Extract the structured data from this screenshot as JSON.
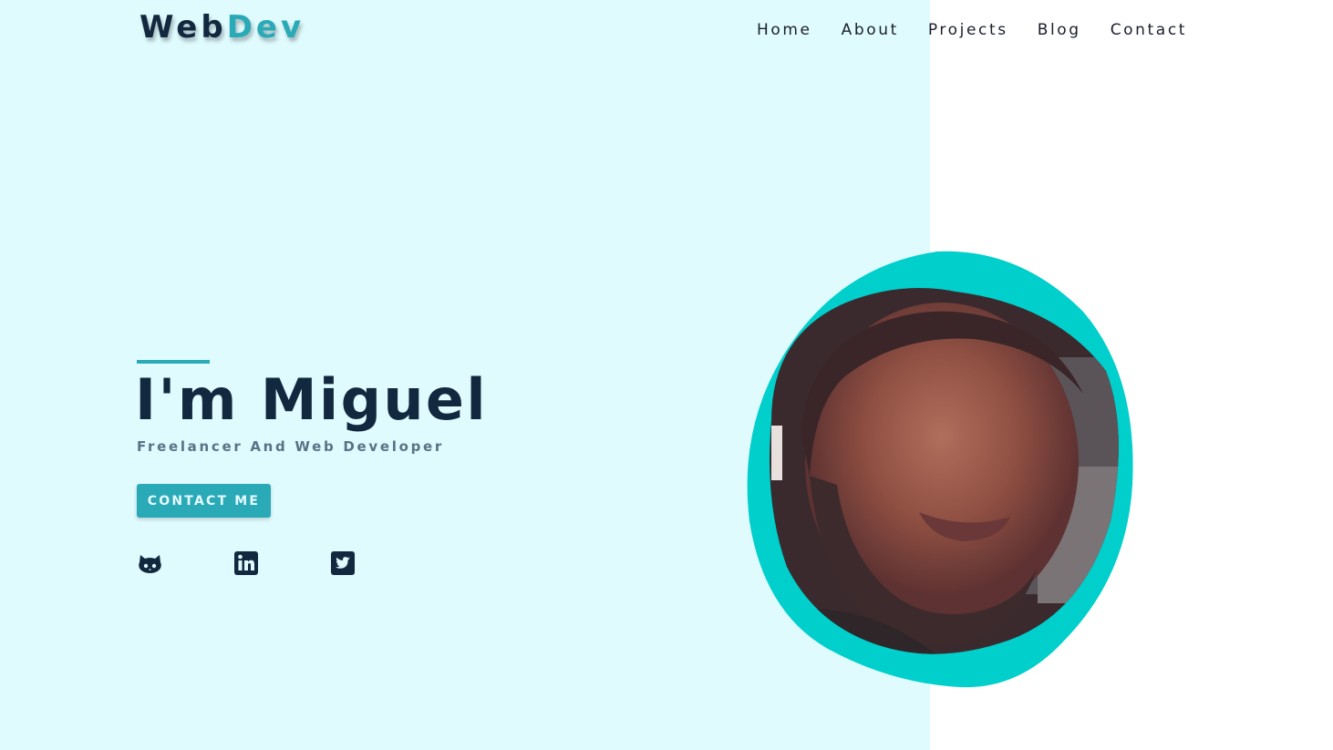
{
  "brand": {
    "logo_part1": "Web",
    "logo_part2": "Dev"
  },
  "nav": {
    "items": [
      {
        "label": "Home"
      },
      {
        "label": "About"
      },
      {
        "label": "Projects"
      },
      {
        "label": "Blog"
      },
      {
        "label": "Contact"
      }
    ]
  },
  "hero": {
    "title": "I'm Miguel",
    "subtitle": "Freelancer And Web Developer",
    "cta_label": "CONTACT ME"
  },
  "social": {
    "icons": [
      "github-icon",
      "linkedin-icon",
      "twitter-icon"
    ]
  },
  "colors": {
    "accent": "#2aa9b7",
    "blob": "#00cfcc",
    "dark_navy": "#12283f",
    "left_bg": "#dffbfe",
    "right_bg": "#ffffff"
  }
}
